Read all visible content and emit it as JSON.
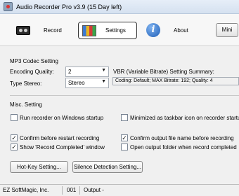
{
  "window": {
    "title": "Audio Recorder Pro v3.9 (15 Day left)"
  },
  "toolbar": {
    "record_label": "Record",
    "settings_label": "Settings",
    "about_label": "About",
    "mini_label": "Mini"
  },
  "mp3": {
    "group_label": "MP3 Codec Setting",
    "encoding_quality_label": "Encoding Quality:",
    "encoding_quality_value": "2",
    "type_stereo_label": "Type Stereo:",
    "type_stereo_value": "Stereo",
    "vbr_summary_label": "VBR (Variable Bitrate) Setting Summary:",
    "vbr_summary_value": "Coding: Default; MAX Bitrate: 192; Quality: 4"
  },
  "misc": {
    "group_label": "Misc. Setting",
    "checkboxes": [
      {
        "label": "Run recorder on Windows startup",
        "checked": false
      },
      {
        "label": "Minimized as taskbar icon on recorder startup",
        "checked": false
      },
      {
        "label": "Confirm before restart recording",
        "checked": true
      },
      {
        "label": "Confirm output file name before recording",
        "checked": true
      },
      {
        "label": "Show 'Record Completed' window",
        "checked": true
      },
      {
        "label": "Open output folder when record completed",
        "checked": false
      }
    ]
  },
  "buttons": {
    "hotkey_label": "Hot-Key Setting...",
    "silence_label": "Silence Detection Setting..."
  },
  "status": {
    "company": "EZ SoftMagic, Inc.",
    "code": "001",
    "output": "Output -"
  },
  "icons": {
    "record": "tape-recorder-icon",
    "settings": "settings-icon",
    "about": "info-icon",
    "app": "app-icon"
  }
}
